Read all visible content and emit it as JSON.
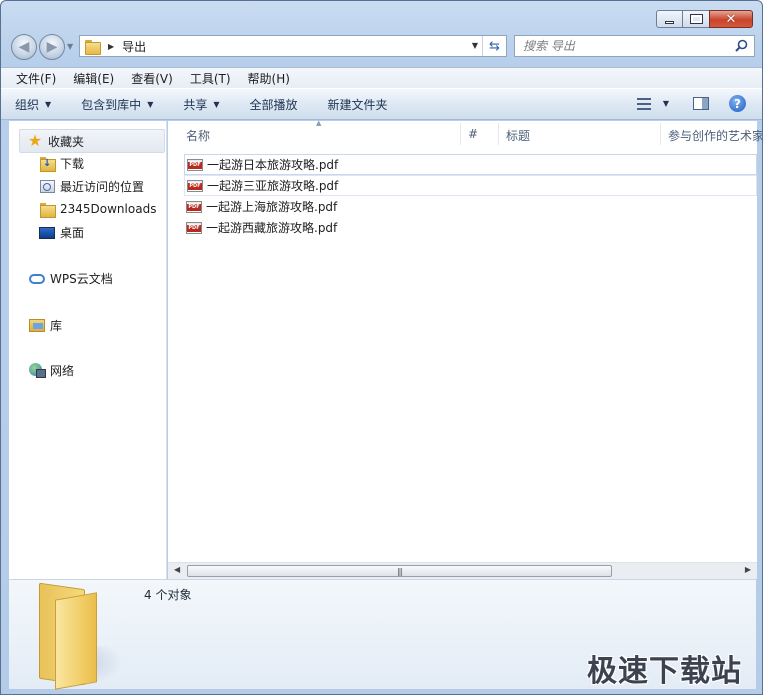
{
  "window": {
    "caption_buttons": [
      "minimize",
      "maximize",
      "close"
    ]
  },
  "address": {
    "path": "导出",
    "search_placeholder": "搜索 导出"
  },
  "menu": {
    "items": [
      "文件(F)",
      "编辑(E)",
      "查看(V)",
      "工具(T)",
      "帮助(H)"
    ]
  },
  "toolbar": {
    "organize": "组织",
    "include_library": "包含到库中",
    "share": "共享",
    "play_all": "全部播放",
    "new_folder": "新建文件夹"
  },
  "nav": {
    "favorites": "收藏夹",
    "downloads": "下载",
    "recent": "最近访问的位置",
    "downloads2345": "2345Downloads",
    "desktop": "桌面",
    "wps_cloud": "WPS云文档",
    "libraries": "库",
    "network": "网络"
  },
  "columns": {
    "name": "名称",
    "number": "#",
    "title": "标题",
    "contributing_artist": "参与创作的艺术家"
  },
  "files": [
    {
      "name": "一起游日本旅游攻略.pdf"
    },
    {
      "name": "一起游三亚旅游攻略.pdf"
    },
    {
      "name": "一起游上海旅游攻略.pdf"
    },
    {
      "name": "一起游西藏旅游攻略.pdf"
    }
  ],
  "details": {
    "count_text": "4 个对象"
  },
  "watermark": "极速下载站",
  "colors": {
    "frame": "#b7cfea",
    "close_red": "#c7452d",
    "accent_blue": "#1f5cc2"
  }
}
